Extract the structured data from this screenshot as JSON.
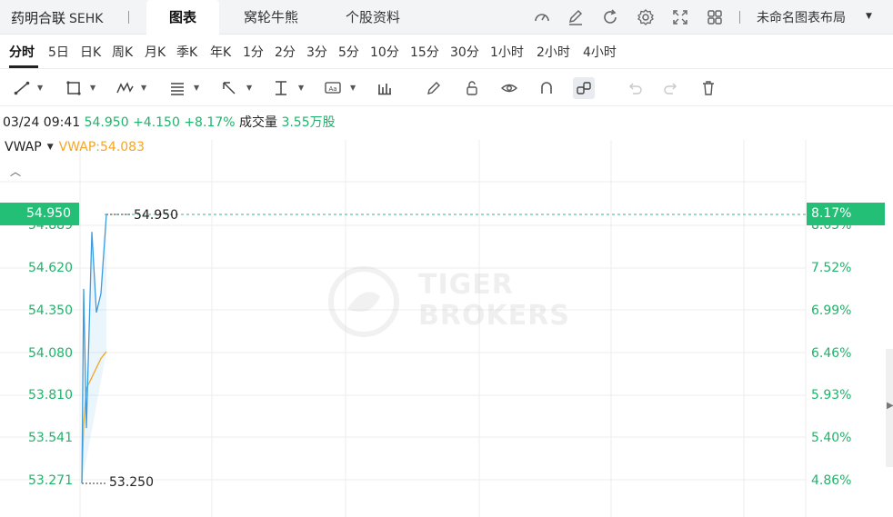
{
  "header": {
    "stock_name": "药明合联",
    "market": "SEHK",
    "tabs": [
      {
        "label": "图表",
        "active": true
      },
      {
        "label": "窝轮牛熊",
        "active": false
      },
      {
        "label": "个股资料",
        "active": false
      }
    ],
    "icons": [
      "gauge-icon",
      "edit-icon",
      "refresh-icon",
      "settings-icon",
      "fullscreen-icon",
      "grid-layout-icon"
    ],
    "layout_name": "未命名图表布局"
  },
  "periods": [
    {
      "label": "分时",
      "active": true
    },
    {
      "label": "5日"
    },
    {
      "label": "日K"
    },
    {
      "label": "周K"
    },
    {
      "label": "月K"
    },
    {
      "label": "季K"
    },
    {
      "label": "年K"
    },
    {
      "label": "1分"
    },
    {
      "label": "2分"
    },
    {
      "label": "3分"
    },
    {
      "label": "5分"
    },
    {
      "label": "10分"
    },
    {
      "label": "15分"
    },
    {
      "label": "30分"
    },
    {
      "label": "1小时"
    },
    {
      "label": "2小时"
    },
    {
      "label": "4小时"
    }
  ],
  "toolbar": {
    "tools": [
      "trend-line-icon",
      "rectangle-icon",
      "wave-pattern-icon",
      "fib-icon",
      "arrow-icon",
      "price-range-icon",
      "text-annotation-icon",
      "bar-indicator-icon",
      "pencil-icon",
      "lock-icon",
      "eye-icon",
      "magnet-icon",
      "link-icon",
      "undo-icon",
      "redo-icon",
      "trash-icon"
    ]
  },
  "quote": {
    "datetime": "03/24 09:41",
    "price": "54.950",
    "change": "+4.150",
    "change_pct": "+8.17%",
    "volume_label": "成交量",
    "volume": "3.55万股"
  },
  "indicator": {
    "label": "VWAP",
    "value": "VWAP:54.083"
  },
  "colors": {
    "up": "#1fb46b",
    "current_badge": "#24bf77",
    "price_line": "#3a9be0",
    "vwap_line": "#f5a623"
  },
  "axes": {
    "left_ticks": [
      "54.889",
      "54.620",
      "54.350",
      "54.080",
      "53.810",
      "53.541",
      "53.271"
    ],
    "right_ticks": [
      "8.05%",
      "7.52%",
      "6.99%",
      "6.46%",
      "5.93%",
      "5.40%",
      "4.86%"
    ],
    "current_price": "54.950",
    "current_pct": "8.17%",
    "high_label": "54.950",
    "low_label": "53.250"
  },
  "watermark": {
    "line1": "TIGER",
    "line2": "BROKERS"
  },
  "chart_data": {
    "type": "line",
    "y_range": [
      53.2,
      55.05
    ],
    "series": [
      {
        "name": "Price",
        "values": [
          53.25,
          54.48,
          53.6,
          54.84,
          54.33,
          54.45,
          54.95
        ]
      },
      {
        "name": "VWAP",
        "values": [
          53.25,
          53.62,
          53.85,
          53.92,
          53.98,
          54.04,
          54.083
        ]
      }
    ]
  }
}
